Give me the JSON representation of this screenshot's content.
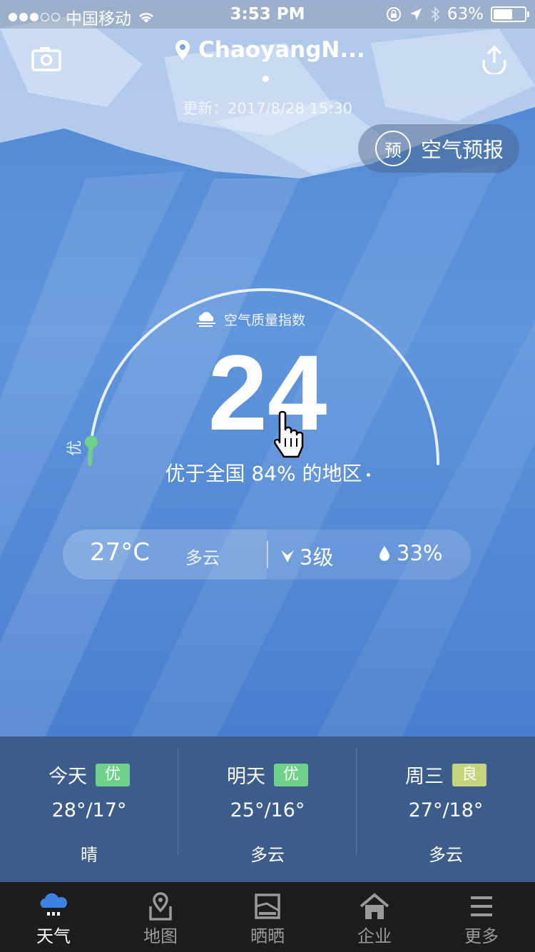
{
  "status_bar": {
    "carrier": "中国移动",
    "time": "3:53 PM",
    "battery": "63%",
    "battery_level": 0.63
  },
  "header": {
    "location": "ChaoyangN...",
    "update_time": "更新：2017/8/28 15:30",
    "forecast_button": {
      "icon_char": "预",
      "label": "空气预报"
    }
  },
  "aqi": {
    "title": "空气质量指数",
    "value": "24",
    "level_label": "优",
    "rank_text": "优于全国 84% 的地区",
    "gauge_fraction": 0.04
  },
  "conditions": {
    "temperature": "27°C",
    "weather": "多云",
    "wind": "3级",
    "humidity": "33%"
  },
  "forecast": [
    {
      "day": "今天",
      "quality": "优",
      "quality_color": "#6fd08a",
      "temps": "28°/17°",
      "weather": "晴"
    },
    {
      "day": "明天",
      "quality": "优",
      "quality_color": "#6fd08a",
      "temps": "25°/16°",
      "weather": "多云"
    },
    {
      "day": "周三",
      "quality": "良",
      "quality_color": "#c4d47a",
      "temps": "27°/18°",
      "weather": "多云"
    }
  ],
  "tabs": [
    {
      "label": "天气",
      "icon": "weather-icon",
      "active": true
    },
    {
      "label": "地图",
      "icon": "map-pin-icon",
      "active": false
    },
    {
      "label": "晒晒",
      "icon": "photo-icon",
      "active": false
    },
    {
      "label": "企业",
      "icon": "home-icon",
      "active": false
    },
    {
      "label": "更多",
      "icon": "menu-icon",
      "active": false
    }
  ],
  "colors": {
    "active_tab_icon": "#3c82e0",
    "gauge_green": "#6fd08a"
  }
}
